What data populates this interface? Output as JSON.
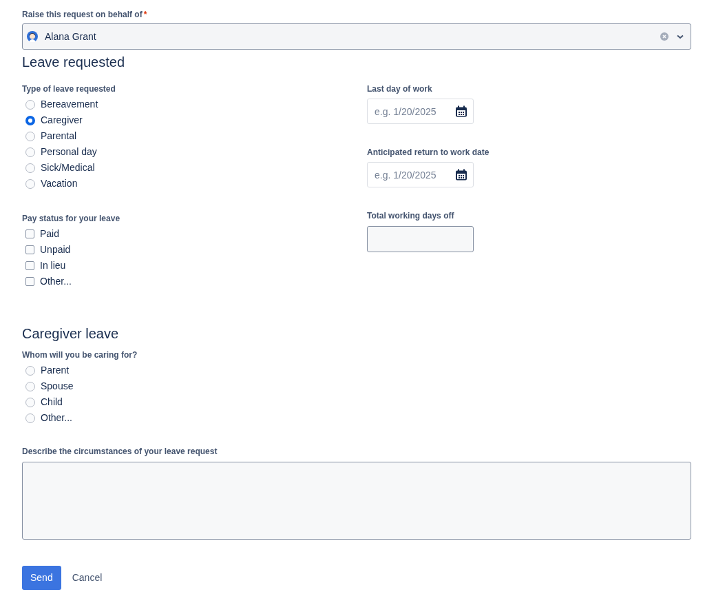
{
  "requester": {
    "label": "Raise this request on behalf of",
    "required_mark": "*",
    "value": "Alana Grant"
  },
  "sections": [
    {
      "title": "Leave requested",
      "left": [
        {
          "kind": "radio",
          "label": "Type of leave requested",
          "options": [
            {
              "label": "Bereavement",
              "selected": false
            },
            {
              "label": "Caregiver",
              "selected": true
            },
            {
              "label": "Parental",
              "selected": false
            },
            {
              "label": "Personal day",
              "selected": false
            },
            {
              "label": "Sick/Medical",
              "selected": false
            },
            {
              "label": "Vacation",
              "selected": false
            }
          ]
        },
        {
          "kind": "checkbox",
          "label": "Pay status for your leave",
          "options": [
            {
              "label": "Paid",
              "checked": false
            },
            {
              "label": "Unpaid",
              "checked": false
            },
            {
              "label": "In lieu",
              "checked": false
            },
            {
              "label": "Other...",
              "checked": false
            }
          ]
        }
      ],
      "right": [
        {
          "kind": "date",
          "label": "Last day of work",
          "placeholder": "e.g. 1/20/2025"
        },
        {
          "kind": "date",
          "label": "Anticipated return to work date",
          "placeholder": "e.g. 1/20/2025"
        },
        {
          "kind": "text",
          "label": "Total working days off"
        }
      ]
    },
    {
      "title": "Caregiver leave",
      "left": [
        {
          "kind": "radio",
          "label": "Whom will you be caring for?",
          "options": [
            {
              "label": "Parent",
              "selected": false
            },
            {
              "label": "Spouse",
              "selected": false
            },
            {
              "label": "Child",
              "selected": false
            },
            {
              "label": "Other...",
              "selected": false
            }
          ]
        }
      ]
    }
  ],
  "description": {
    "label": "Describe the circumstances of your leave request"
  },
  "buttons": [
    {
      "kind": "primary",
      "label": "Send"
    },
    {
      "kind": "link",
      "label": "Cancel"
    }
  ]
}
